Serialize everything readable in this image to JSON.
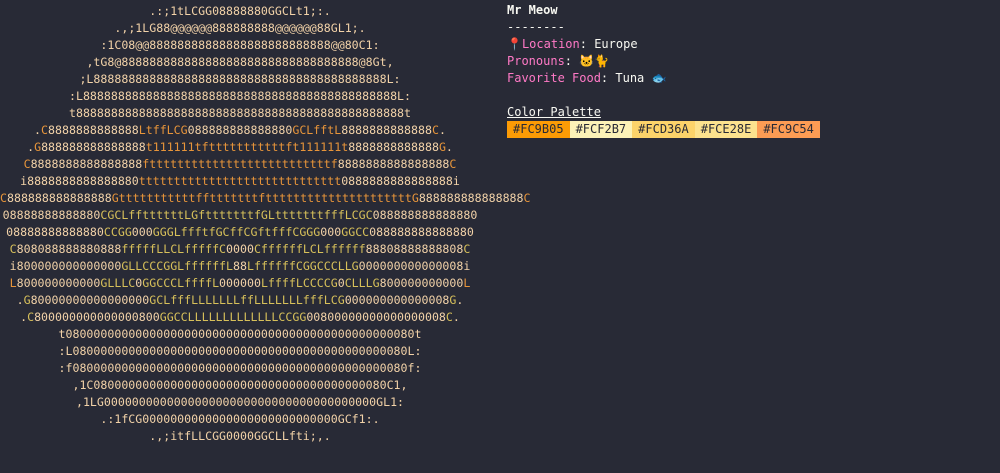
{
  "art_lines": [
    ".:;1tLCGG08888880GGCLt1;:.",
    ".,;1LG88@@@@@@888888888@@@@@@88GL1;.",
    ":1C08@@88888888888888888888888888@@80C1:",
    ",tG8@8888888888888888888888888888888888@8Gt,",
    ";L888888888888888888888888888888888888888888L:",
    ":L888888888888888888888888888888888888888888888L:",
    "t88888888888888888888888888888888888888888888888t",
    ".C8888888888888LtffLCG088888888888880GCLfftL8888888888888C.",
    ".G888888888888888t111111tftttttttttttft111111t8888888888888G.",
    "C8888888888888888fttttttttttttttttttttttttttf8888888888888888C",
    "i8888888888888880ttttttttttttttttttttttttttttt0888888888888888i",
    "C888888888888888GtttttttttttfftttttttftttttttttttttttttttttG888888888888888C",
    "08888888888880CGCLffttttttLGftttttttfGLtttttttfffLCGC088888888888880",
    "08888888888880CCGG000GGGLffftfGCffCGftfffCGGG000GGCC088888888888880",
    "C808088888880888fffffLLCLfffffC0000CffffffLCLffffff88808888888808C",
    "i800000000000000GLLCCCGGLffffffL88LffffffCGGCCCLLG000000000000008i",
    "L800000000000GLLLC0GGCCCLffffL000000LffffLCCCCG0CLLLG800000000000L",
    ".G80000000000000000GCLfffLLLLLLLffLLLLLLLfffLCG000000000000008G.",
    ".C800000000000000800GGCCLLLLLLLLLLLLLCCGG00800000000000000008C.",
    "t08000000000000000000000000000000000000000000000080t",
    ":L080000000000000000000000000000000000000000000080L:",
    ":f080000000000000000000000000000000000000000000080f:",
    ",1C080000000000000000000000000000000000000080C1,",
    ",1LG000000000000000000000000000000000000000GL1:",
    ".:1fCG0000000000000000000000000000GCf1:.",
    ".,;itfLLCGG0000GGCLLfti;,."
  ],
  "info": {
    "name": "Mr Meow",
    "separator": "--------",
    "location_icon": "📍",
    "location_label": "Location",
    "location_value": "Europe",
    "pronouns_label": "Pronouns",
    "pronouns_value": "🐱🐈",
    "food_label": "Favorite Food",
    "food_value": "Tuna 🐟",
    "palette_title": "Color Palette",
    "palette": [
      {
        "hex": "#FC9B05",
        "label": "#FC9B05"
      },
      {
        "hex": "#FCF2B7",
        "label": "#FCF2B7"
      },
      {
        "hex": "#FCD36A",
        "label": "#FCD36A"
      },
      {
        "hex": "#FCE28E",
        "label": "#FCE28E"
      },
      {
        "hex": "#FC9C54",
        "label": "#FC9C54"
      }
    ]
  }
}
